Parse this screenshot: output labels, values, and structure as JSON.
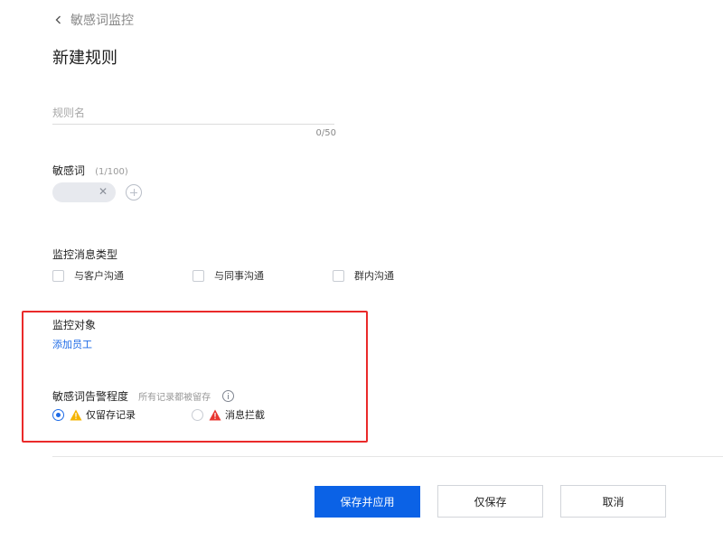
{
  "breadcrumb": {
    "back_label": "敏感词监控"
  },
  "page": {
    "title": "新建规则"
  },
  "rule_name": {
    "placeholder": "规则名",
    "value": "",
    "counter": "0/50"
  },
  "sensitive_words": {
    "label": "敏感词",
    "count": "(1/100)",
    "chips": [
      {
        "text": ""
      }
    ]
  },
  "message_types": {
    "label": "监控消息类型",
    "options": [
      {
        "label": "与客户沟通",
        "checked": false
      },
      {
        "label": "与同事沟通",
        "checked": false
      },
      {
        "label": "群内沟通",
        "checked": false
      }
    ]
  },
  "monitor_target": {
    "label": "监控对象",
    "add_link": "添加员工"
  },
  "alert_level": {
    "label": "敏感词告警程度",
    "hint": "所有记录都被留存",
    "options": [
      {
        "label": "仅留存记录",
        "selected": true,
        "icon": "warning-yellow-icon"
      },
      {
        "label": "消息拦截",
        "selected": false,
        "icon": "warning-red-icon"
      }
    ]
  },
  "actions": {
    "save_apply": "保存并应用",
    "save_only": "仅保存",
    "cancel": "取消"
  },
  "colors": {
    "primary": "#0b62e6",
    "link": "#1e6be6",
    "highlight": "#ea2a2a",
    "warn_yellow": "#f5b400",
    "warn_red": "#e8362f"
  }
}
